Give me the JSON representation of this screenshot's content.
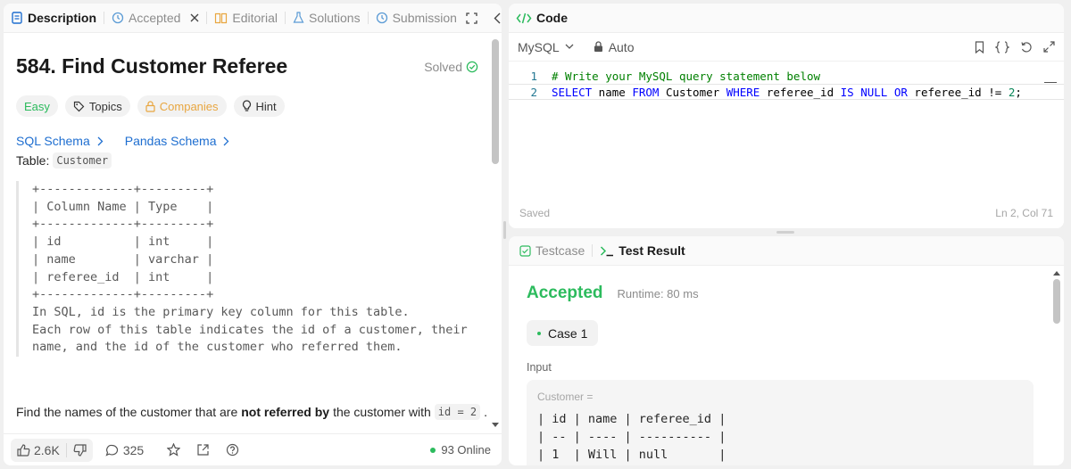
{
  "left_tabs": [
    {
      "label": "Description"
    },
    {
      "label": "Accepted"
    },
    {
      "label": "Editorial"
    },
    {
      "label": "Solutions"
    },
    {
      "label": "Submission"
    }
  ],
  "problem": {
    "title": "584. Find Customer Referee",
    "status": "Solved",
    "tags": {
      "difficulty": "Easy",
      "topics": "Topics",
      "companies": "Companies",
      "hint": "Hint"
    },
    "schema_links": [
      "SQL Schema",
      "Pandas Schema"
    ],
    "table_prefix": "Table:",
    "table_name": "Customer",
    "schema_block": "+-------------+---------+\n| Column Name | Type    |\n+-------------+---------+\n| id          | int     |\n| name        | varchar |\n| referee_id  | int     |\n+-------------+---------+\nIn SQL, id is the primary key column for this table.\nEach row of this table indicates the id of a customer, their\nname, and the id of the customer who referred them.",
    "desc_pre": "Find the names of the customer that are",
    "desc_bold": "not referred by",
    "desc_post": "the customer with",
    "desc_code": "id = 2",
    "desc_end": "."
  },
  "footer": {
    "likes": "2.6K",
    "comments": "325",
    "online": "93 Online"
  },
  "code_panel": {
    "title": "Code",
    "language": "MySQL",
    "mode": "Auto",
    "lines": [
      {
        "num": "1",
        "comment": "# Write your MySQL query statement below"
      },
      {
        "num": "2"
      }
    ],
    "line2_tokens": {
      "kw1": "SELECT",
      "t1": " name ",
      "kw2": "FROM",
      "t2": " Customer ",
      "kw3": "WHERE",
      "t3": " referee_id ",
      "kw4": "IS NULL OR",
      "t4": " referee_id ",
      "kw5": "!=",
      "t5": " ",
      "n1": "2",
      "t6": ";"
    },
    "status_left": "Saved",
    "status_right": "Ln 2, Col 71"
  },
  "result_panel": {
    "tabs": [
      {
        "label": "Testcase"
      },
      {
        "label": "Test Result"
      }
    ],
    "verdict": "Accepted",
    "runtime": "Runtime: 80 ms",
    "case_label": "Case 1",
    "input_label": "Input",
    "input_var": "Customer =",
    "input_table": "| id | name | referee_id |\n| -- | ---- | ---------- |\n| 1  | Will | null       |"
  },
  "colors": {
    "accent_green": "#2cbb5d",
    "link_blue": "#1e6ed0",
    "companies_orange": "#e8a640"
  }
}
